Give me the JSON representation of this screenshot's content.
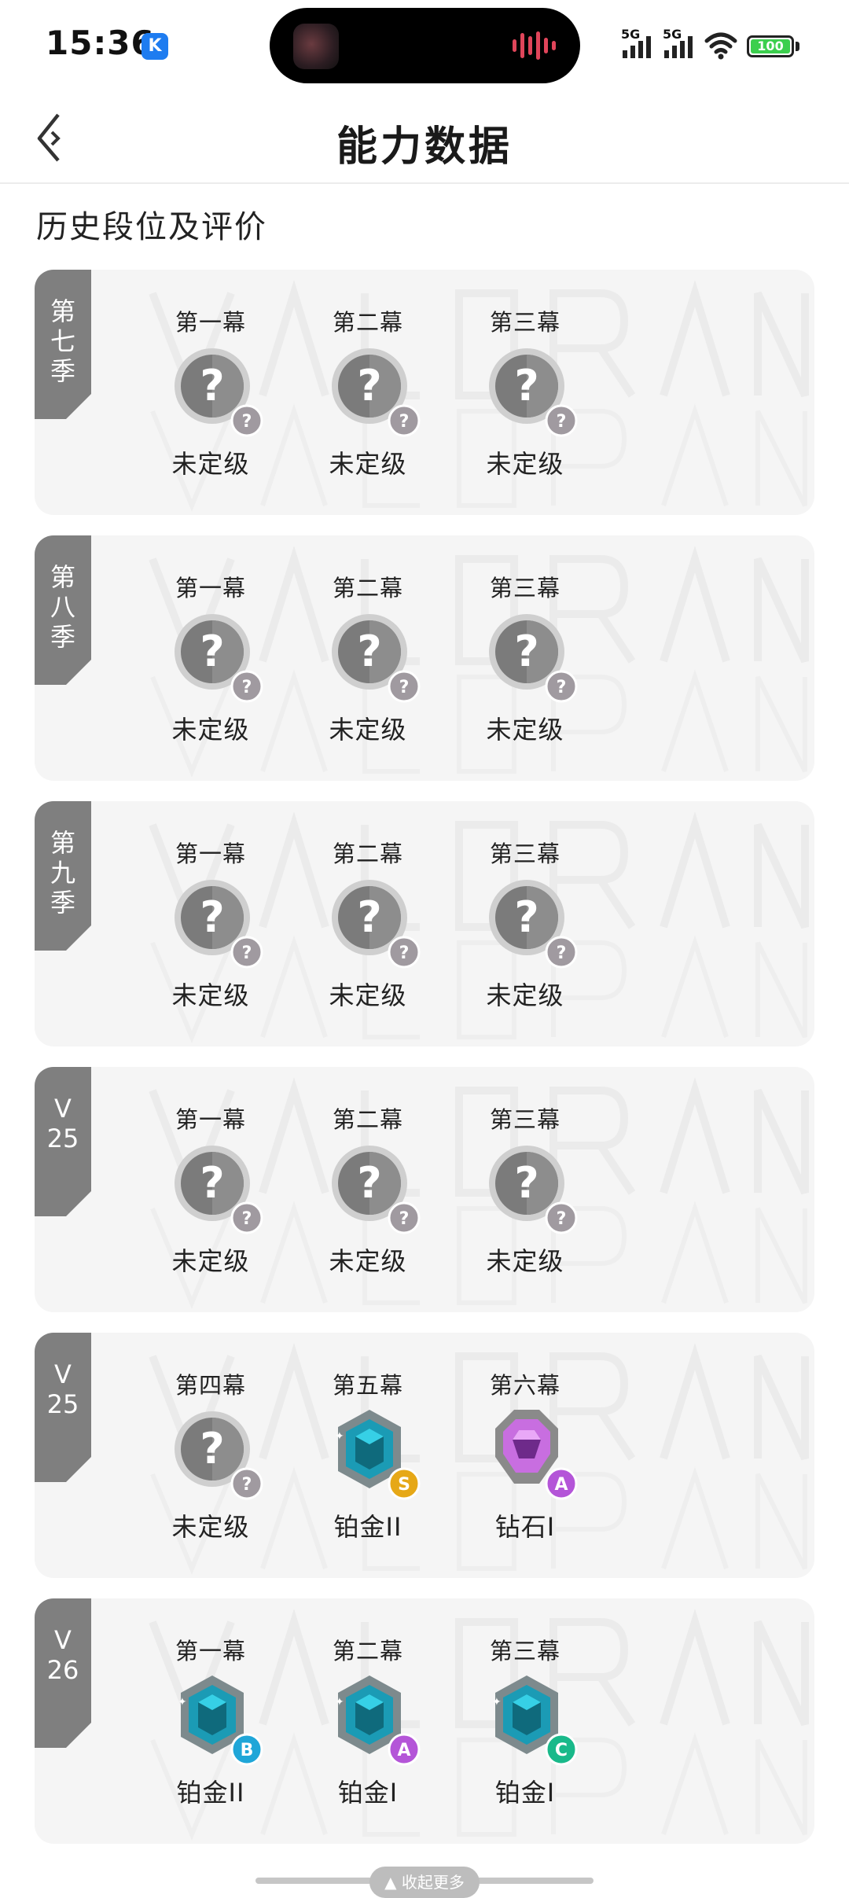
{
  "status_bar": {
    "time": "15:36",
    "k_badge": "K",
    "signal_1": "5G",
    "signal_2": "5G",
    "battery": "100",
    "battery_color": "#3ccf4e"
  },
  "header": {
    "title": "能力数据",
    "back_icon": "back-chevron-icon"
  },
  "section_title": "历史段位及评价",
  "seasons": [
    {
      "label": "第\n七\n季",
      "acts": [
        {
          "act": "第一幕",
          "rank": "未定级",
          "icon": "unranked",
          "grade": "?"
        },
        {
          "act": "第二幕",
          "rank": "未定级",
          "icon": "unranked",
          "grade": "?"
        },
        {
          "act": "第三幕",
          "rank": "未定级",
          "icon": "unranked",
          "grade": "?"
        }
      ]
    },
    {
      "label": "第\n八\n季",
      "acts": [
        {
          "act": "第一幕",
          "rank": "未定级",
          "icon": "unranked",
          "grade": "?"
        },
        {
          "act": "第二幕",
          "rank": "未定级",
          "icon": "unranked",
          "grade": "?"
        },
        {
          "act": "第三幕",
          "rank": "未定级",
          "icon": "unranked",
          "grade": "?"
        }
      ]
    },
    {
      "label": "第\n九\n季",
      "acts": [
        {
          "act": "第一幕",
          "rank": "未定级",
          "icon": "unranked",
          "grade": "?"
        },
        {
          "act": "第二幕",
          "rank": "未定级",
          "icon": "unranked",
          "grade": "?"
        },
        {
          "act": "第三幕",
          "rank": "未定级",
          "icon": "unranked",
          "grade": "?"
        }
      ]
    },
    {
      "label": "V\n25",
      "acts": [
        {
          "act": "第一幕",
          "rank": "未定级",
          "icon": "unranked",
          "grade": "?"
        },
        {
          "act": "第二幕",
          "rank": "未定级",
          "icon": "unranked",
          "grade": "?"
        },
        {
          "act": "第三幕",
          "rank": "未定级",
          "icon": "unranked",
          "grade": "?"
        }
      ]
    },
    {
      "label": "V\n25",
      "acts": [
        {
          "act": "第四幕",
          "rank": "未定级",
          "icon": "unranked",
          "grade": "?"
        },
        {
          "act": "第五幕",
          "rank": "铂金II",
          "icon": "platinum",
          "grade": "S",
          "grade_color": "#e6a817"
        },
        {
          "act": "第六幕",
          "rank": "钻石I",
          "icon": "diamond",
          "grade": "A",
          "grade_color": "#b455d8"
        }
      ]
    },
    {
      "label": "V\n26",
      "acts": [
        {
          "act": "第一幕",
          "rank": "铂金II",
          "icon": "platinum",
          "grade": "B",
          "grade_color": "#1fa6d8"
        },
        {
          "act": "第二幕",
          "rank": "铂金I",
          "icon": "platinum",
          "grade": "A",
          "grade_color": "#b455d8"
        },
        {
          "act": "第三幕",
          "rank": "铂金I",
          "icon": "platinum",
          "grade": "C",
          "grade_color": "#19b98a"
        }
      ]
    }
  ],
  "bottom_pill": "▲ 收起更多",
  "watermark": "VALORANT"
}
